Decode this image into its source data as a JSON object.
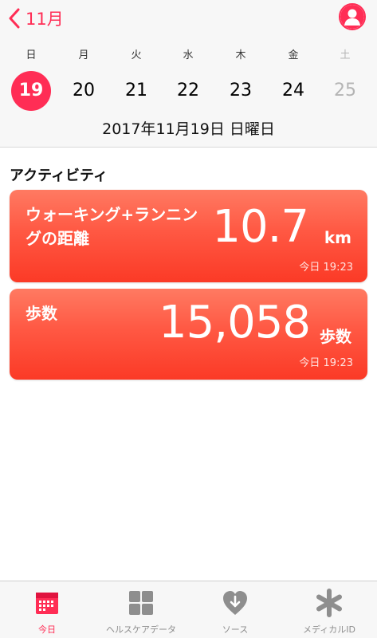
{
  "header": {
    "back_label": "11月"
  },
  "calendar": {
    "weekdays": [
      "日",
      "月",
      "火",
      "水",
      "木",
      "金",
      "土"
    ],
    "dates": [
      "19",
      "20",
      "21",
      "22",
      "23",
      "24",
      "25"
    ],
    "selected_index": 0,
    "full_date": "2017年11月19日 日曜日"
  },
  "section": {
    "title": "アクティビティ"
  },
  "cards": [
    {
      "label": "ウォーキング+ランニングの距離",
      "value": "10.7",
      "unit": "km",
      "time": "今日 19:23"
    },
    {
      "label": "歩数",
      "value": "15,058",
      "unit": "歩数",
      "time": "今日 19:23"
    }
  ],
  "tabbar": {
    "tabs": [
      {
        "label": "今日",
        "icon": "calendar-today-icon"
      },
      {
        "label": "ヘルスケアデータ",
        "icon": "health-data-grid-icon"
      },
      {
        "label": "ソース",
        "icon": "sources-heart-icon"
      },
      {
        "label": "メディカルID",
        "icon": "medical-id-star-icon"
      }
    ],
    "active_index": 0
  },
  "colors": {
    "accent": "#ff2d55",
    "card_gradient_top": "#ff7a62",
    "card_gradient_bottom": "#fb3a26",
    "inactive": "#8e8e8e"
  }
}
